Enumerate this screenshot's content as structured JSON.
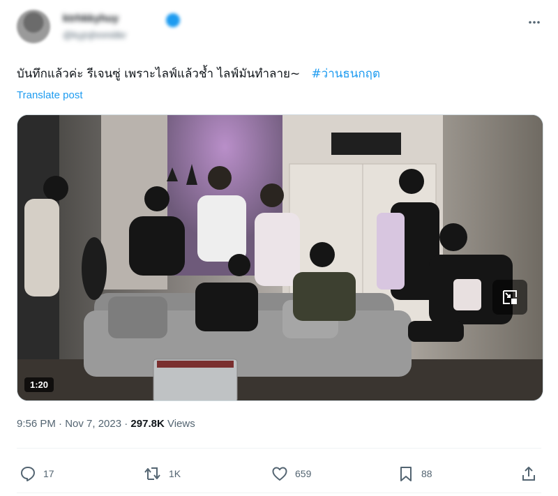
{
  "post": {
    "author_display_name": "ktrhkkyhuy",
    "author_handle": "@kyjnjhnmiitkr",
    "more_label": "···",
    "text_main": "บันทึกแล้วค่ะ รีเจนซู่ เพราะไลฟ์แล้วช้ำ ไลฟ์มันทำลาย~",
    "hashtag": "#ว่านธนกฤต",
    "translate_label": "Translate post",
    "video_duration": "1:20",
    "timestamp": "9:56 PM · Nov 7, 2023 · ",
    "views_count": "297.8K",
    "views_label": " Views"
  },
  "actions": {
    "replies": "17",
    "reposts": "1K",
    "likes": "659",
    "bookmarks": "88"
  },
  "icons": [
    "more-icon",
    "verified-icon",
    "pip-icon",
    "reply-icon",
    "repost-icon",
    "like-icon",
    "bookmark-icon",
    "share-icon"
  ],
  "colors": {
    "accent": "#1d9bf0",
    "text": "#0f1419",
    "muted": "#536471",
    "divider": "#eff3f4"
  }
}
